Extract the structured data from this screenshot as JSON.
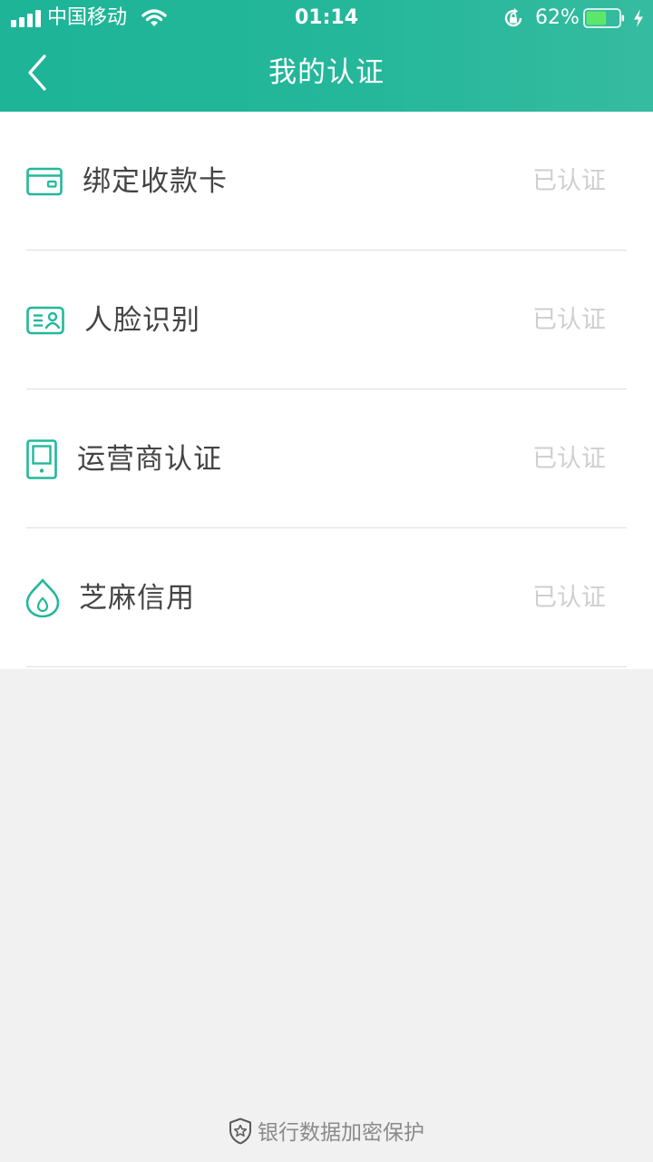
{
  "status_bar": {
    "carrier": "中国移动",
    "time": "01:14",
    "battery_percent": "62%",
    "battery_level": 0.62,
    "icons": [
      "signal-icon",
      "wifi-icon",
      "orientation-lock-icon",
      "battery-icon",
      "charging-icon"
    ]
  },
  "header": {
    "title": "我的认证",
    "back_icon": "chevron-left-icon"
  },
  "items": [
    {
      "label": "绑定收款卡",
      "status": "已认证",
      "icon": "bank-card-icon"
    },
    {
      "label": "人脸识别",
      "status": "已认证",
      "icon": "id-card-face-icon"
    },
    {
      "label": "运营商认证",
      "status": "已认证",
      "icon": "mobile-phone-icon"
    },
    {
      "label": "芝麻信用",
      "status": "已认证",
      "icon": "sesame-credit-icon"
    }
  ],
  "footer": {
    "text": "银行数据加密保护",
    "icon": "shield-star-icon"
  },
  "colors": {
    "header_start": "#1db497",
    "header_end": "#35bba0",
    "accent": "#22b89b",
    "label": "#444444",
    "status": "#cfcfcf",
    "background": "#f1f1f1"
  }
}
